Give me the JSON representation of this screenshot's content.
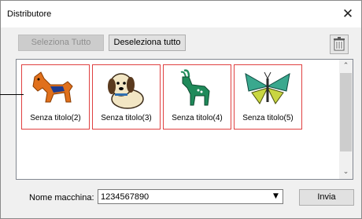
{
  "window": {
    "title": "Distributore",
    "close_glyph": "✕"
  },
  "toolbar": {
    "select_all_label": "Seleziona Tutto",
    "deselect_all_label": "Deseleziona tutto",
    "trash_icon": "trash-icon"
  },
  "designs": [
    {
      "label": "Senza titolo(2)",
      "icon": "horse-icon"
    },
    {
      "label": "Senza titolo(3)",
      "icon": "dog-icon"
    },
    {
      "label": "Senza titolo(4)",
      "icon": "goat-icon"
    },
    {
      "label": "Senza titolo(5)",
      "icon": "butterfly-icon"
    }
  ],
  "machine": {
    "label": "Nome macchina:",
    "value": "1234567890"
  },
  "send_label": "Invia",
  "colors": {
    "tile_border": "#e04040",
    "horse": "#e0701c",
    "goat": "#1f8a5a",
    "butterfly": "#3aa88e"
  }
}
